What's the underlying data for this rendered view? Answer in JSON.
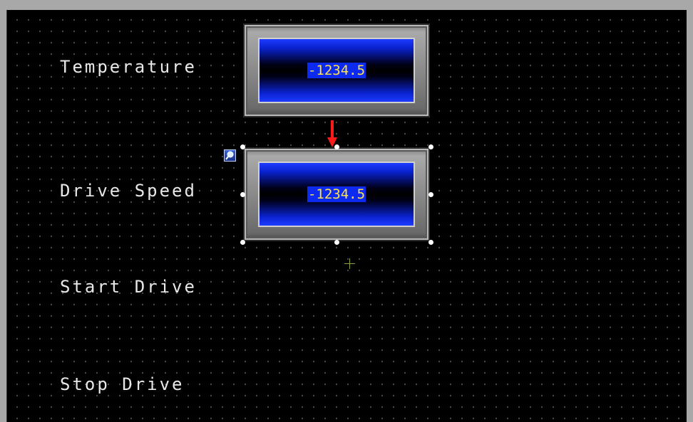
{
  "labels": {
    "temperature": "Temperature",
    "drive_speed": "Drive Speed",
    "start_drive": "Start Drive",
    "stop_drive": "Stop Drive"
  },
  "displays": {
    "temperature_value": "-1234.5",
    "drive_speed_value": "-1234.5"
  },
  "colors": {
    "canvas": "#000000",
    "grid_dot": "#5c5c5c",
    "label_text": "#e8e8e8",
    "value_text": "#ffe24a",
    "value_bg": "#0d2bf0",
    "arrow": "#ff1a1a",
    "crosshair": "#8aa040"
  },
  "icons": {
    "selection_arrow": "red-down-arrow-icon",
    "object_finder": "magnifier-icon",
    "insertion_point": "crosshair-icon"
  }
}
